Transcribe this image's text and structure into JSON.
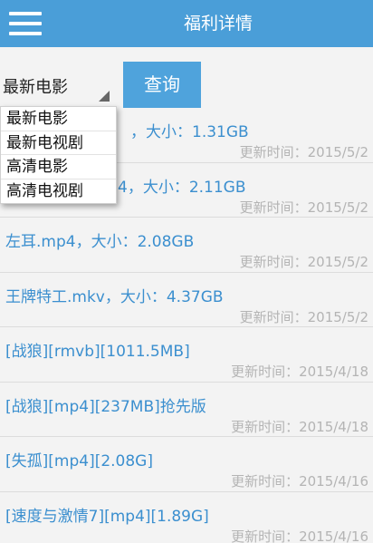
{
  "header": {
    "title": "福利详情",
    "menu_icon": "hamburger-menu-icon"
  },
  "search": {
    "selected": "最新电影",
    "query_label": "查询"
  },
  "dropdown": {
    "options": [
      "最新电影",
      "最新电视剧",
      "高清电影",
      "高清电视剧"
    ]
  },
  "list": {
    "items": [
      {
        "title": "",
        "visible_title": "，大小：1.31GB",
        "time": "更新时间：2015/5/2"
      },
      {
        "title": "",
        "visible_title": "4，大小：2.11GB",
        "time": "更新时间：2015/5/2"
      },
      {
        "title": "左耳.mp4，大小：2.08GB",
        "time": "更新时间：2015/5/2"
      },
      {
        "title": "王牌特工.mkv，大小：4.37GB",
        "time": "更新时间：2015/5/2"
      },
      {
        "title": "[战狼][rmvb][1011.5MB]",
        "time": "更新时间：2015/4/18"
      },
      {
        "title": "[战狼][mp4][237MB]抢先版",
        "time": "更新时间：2015/4/18"
      },
      {
        "title": "[失孤][mp4][2.08G]",
        "time": "更新时间：2015/4/16"
      },
      {
        "title": "[速度与激情7][mp4][1.89G]",
        "time": "更新时间：2015/4/16"
      }
    ]
  },
  "colors": {
    "header_bg": "#4a9ed8",
    "button_bg": "#4fa3dc",
    "link_text": "#3b8fcf",
    "muted_text": "#b4b4b4"
  }
}
